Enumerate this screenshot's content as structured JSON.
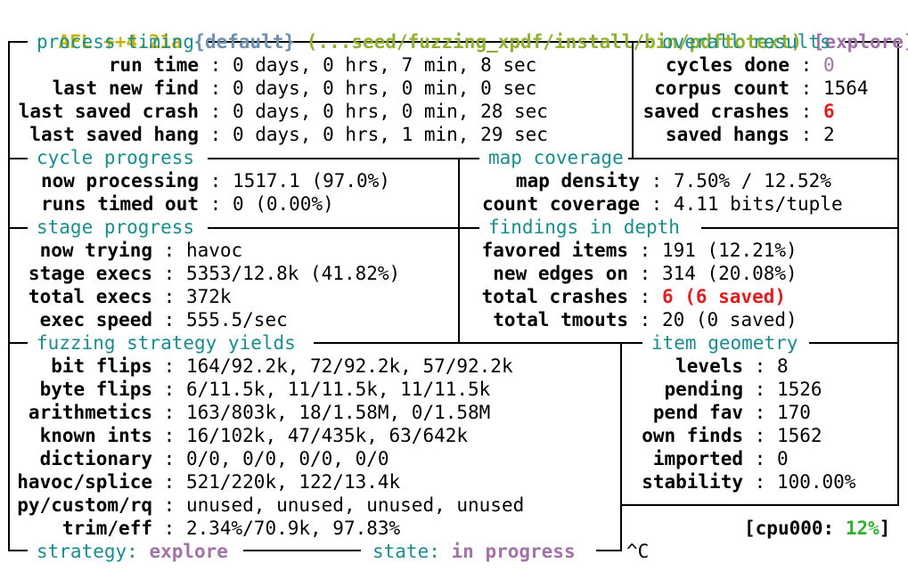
{
  "colors": {
    "text": "#000000",
    "background": "#ffffff",
    "header_afl": "#c8b400",
    "header_profile": "#6d8fb0",
    "header_target": "#8fb030",
    "header_mode": "#a273a6",
    "section_title": "#1a8c8c",
    "value_red": "#e02020",
    "value_purple": "#a273a6",
    "cpu_pct": "#30b030"
  },
  "header": {
    "afl": "AFL",
    "version": "++4.21a",
    "profile": "{default}",
    "target": "(...seed/fuzzing_xpdf/install/bin/pdftotext)",
    "mode": "[explore]"
  },
  "process_timing": {
    "title": "process timing",
    "rows": [
      {
        "label": "run time",
        "value": "0 days, 0 hrs, 7 min, 8 sec"
      },
      {
        "label": "last new find",
        "value": "0 days, 0 hrs, 0 min, 0 sec"
      },
      {
        "label": "last saved crash",
        "value": "0 days, 0 hrs, 0 min, 28 sec"
      },
      {
        "label": "last saved hang",
        "value": "0 days, 0 hrs, 1 min, 29 sec"
      }
    ]
  },
  "overall_results": {
    "title": "overall results",
    "rows": [
      {
        "label": "cycles done",
        "value": "0"
      },
      {
        "label": "corpus count",
        "value": "1564"
      },
      {
        "label": "saved crashes",
        "value": "6"
      },
      {
        "label": "saved hangs",
        "value": "2"
      }
    ]
  },
  "cycle_progress": {
    "title": "cycle progress",
    "rows": [
      {
        "label": "now processing",
        "value": "1517.1 (97.0%)"
      },
      {
        "label": "runs timed out",
        "value": "0 (0.00%)"
      }
    ]
  },
  "map_coverage": {
    "title": "map coverage",
    "rows": [
      {
        "label": "map density",
        "value": "7.50% / 12.52%"
      },
      {
        "label": "count coverage",
        "value": "4.11 bits/tuple"
      }
    ]
  },
  "stage_progress": {
    "title": "stage progress",
    "rows": [
      {
        "label": "now trying",
        "value": "havoc"
      },
      {
        "label": "stage execs",
        "value": "5353/12.8k (41.82%)"
      },
      {
        "label": "total execs",
        "value": "372k"
      },
      {
        "label": "exec speed",
        "value": "555.5/sec"
      }
    ]
  },
  "findings_in_depth": {
    "title": "findings in depth",
    "rows": [
      {
        "label": "favored items",
        "value": "191 (12.21%)"
      },
      {
        "label": "new edges on",
        "value": "314 (20.08%)"
      },
      {
        "label": "total crashes",
        "value": "6 (6 saved)"
      },
      {
        "label": "total tmouts",
        "value": "20 (0 saved)"
      }
    ]
  },
  "fuzzing_strategy_yields": {
    "title": "fuzzing strategy yields",
    "rows": [
      {
        "label": "bit flips",
        "value": "164/92.2k, 72/92.2k, 57/92.2k"
      },
      {
        "label": "byte flips",
        "value": "6/11.5k, 11/11.5k, 11/11.5k"
      },
      {
        "label": "arithmetics",
        "value": "163/803k, 18/1.58M, 0/1.58M"
      },
      {
        "label": "known ints",
        "value": "16/102k, 47/435k, 63/642k"
      },
      {
        "label": "dictionary",
        "value": "0/0, 0/0, 0/0, 0/0"
      },
      {
        "label": "havoc/splice",
        "value": "521/220k, 122/13.4k"
      },
      {
        "label": "py/custom/rq",
        "value": "unused, unused, unused, unused"
      },
      {
        "label": "trim/eff",
        "value": "2.34%/70.9k, 97.83%"
      }
    ]
  },
  "item_geometry": {
    "title": "item geometry",
    "rows": [
      {
        "label": "levels",
        "value": "8"
      },
      {
        "label": "pending",
        "value": "1526"
      },
      {
        "label": "pend fav",
        "value": "170"
      },
      {
        "label": "own finds",
        "value": "1562"
      },
      {
        "label": "imported",
        "value": "0"
      },
      {
        "label": "stability",
        "value": "100.00%"
      }
    ]
  },
  "cpu": {
    "label": "cpu000:",
    "percent": "12%"
  },
  "footer": {
    "strategy_label": "strategy:",
    "strategy_value": "explore",
    "state_label": "state:",
    "state_value": "in progress",
    "interrupt": "^C"
  }
}
